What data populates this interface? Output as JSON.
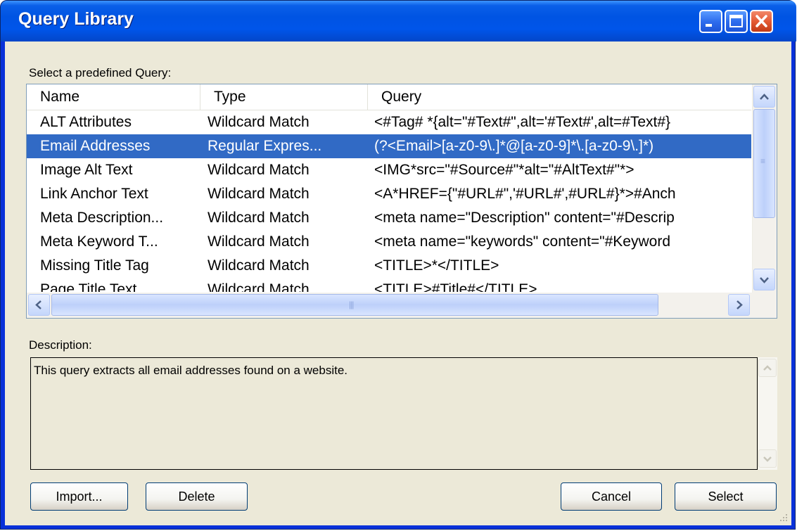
{
  "window": {
    "title": "Query Library"
  },
  "list": {
    "label": "Select a predefined Query:",
    "columns": [
      "Name",
      "Type",
      "Query"
    ],
    "rows": [
      {
        "name": "ALT Attributes",
        "type": "Wildcard Match",
        "query": "<#Tag# *{alt=\"#Text#\",alt='#Text#',alt=#Text#}"
      },
      {
        "name": "Email Addresses",
        "type": "Regular Expres...",
        "query": "(?<Email>[a-z0-9\\.]*@[a-z0-9]*\\.[a-z0-9\\.]*)"
      },
      {
        "name": "Image Alt Text",
        "type": "Wildcard Match",
        "query": "<IMG*src=\"#Source#\"*alt=\"#AltText#\"*>"
      },
      {
        "name": "Link Anchor Text",
        "type": "Wildcard Match",
        "query": "<A*HREF={\"#URL#\",'#URL#',#URL#}*>#Anch"
      },
      {
        "name": "Meta Description...",
        "type": "Wildcard Match",
        "query": "<meta name=\"Description\" content=\"#Descrip"
      },
      {
        "name": "Meta Keyword T...",
        "type": "Wildcard Match",
        "query": "<meta name=\"keywords\" content=\"#Keyword"
      },
      {
        "name": "Missing Title Tag",
        "type": "Wildcard Match",
        "query": "<TITLE>*</TITLE>"
      },
      {
        "name": "Page Title Text",
        "type": "Wildcard Match",
        "query": "<TITLE>#Title#</TITLE>"
      }
    ],
    "selected_row": "Email Addresses"
  },
  "description": {
    "label": "Description:",
    "text": "This query extracts all email addresses found on a website."
  },
  "buttons": {
    "import": "Import...",
    "delete": "Delete",
    "cancel": "Cancel",
    "select": "Select"
  },
  "colors": {
    "title_bar": "#0054e3",
    "selection": "#316ac5",
    "dialog_bg": "#ece9d8",
    "close_button": "#e45a34"
  }
}
